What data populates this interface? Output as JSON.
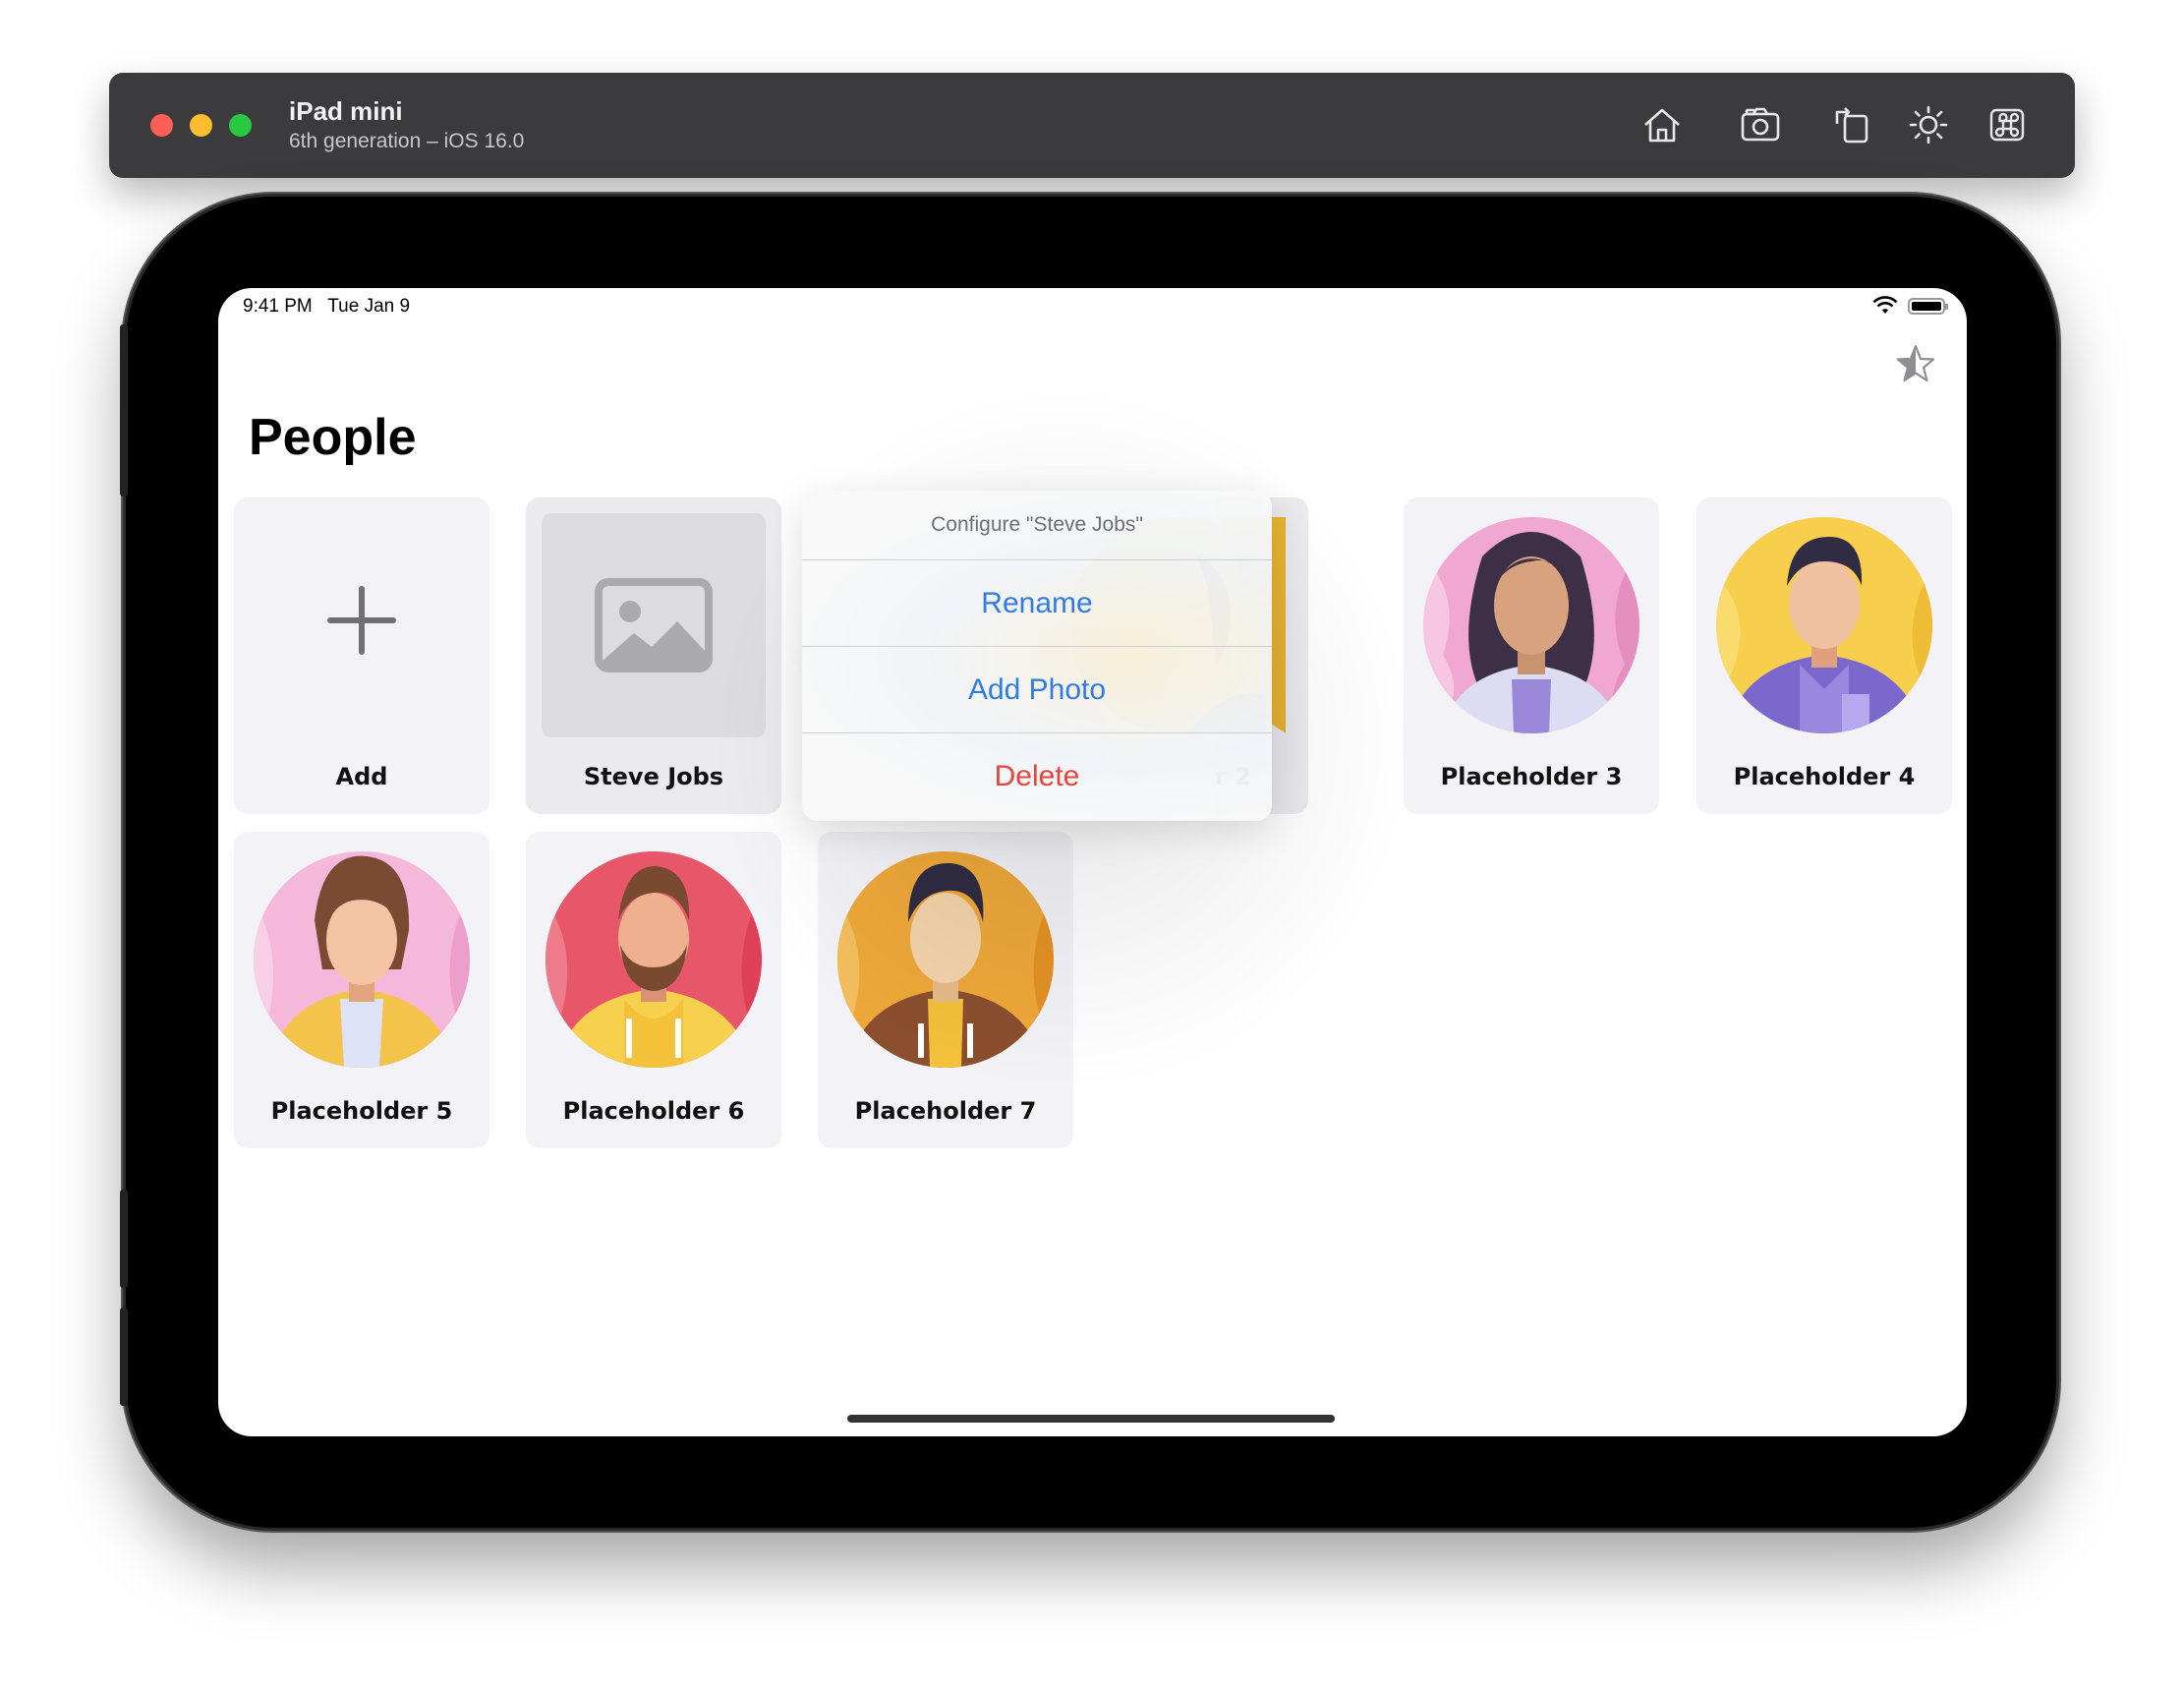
{
  "window": {
    "title": "iPad mini",
    "subtitle": "6th generation – iOS 16.0",
    "toolbar_icons": [
      "home-icon",
      "screenshot-icon",
      "rotate-icon",
      "appearance-icon",
      "command-icon"
    ]
  },
  "status_bar": {
    "time": "9:41 PM   Tue Jan 9"
  },
  "page": {
    "title": "People",
    "favorite_icon": "star-icon"
  },
  "grid": {
    "add_label": "Add",
    "people": [
      {
        "name": "Steve Jobs",
        "avatar": "image-placeholder-icon"
      },
      {
        "name": "r 2",
        "avatar": "avatar-yellow-bg"
      },
      {
        "name": "Placeholder 3",
        "avatar": "avatar-woman-pink-bg"
      },
      {
        "name": "Placeholder 4",
        "avatar": "avatar-man-yellow-bg"
      },
      {
        "name": "Placeholder 5",
        "avatar": "avatar-woman-pink-bg"
      },
      {
        "name": "Placeholder 6",
        "avatar": "avatar-bearded-red-bg"
      },
      {
        "name": "Placeholder 7",
        "avatar": "avatar-man-orange-bg"
      }
    ]
  },
  "context_menu": {
    "header": "Configure \"Steve Jobs\"",
    "items": [
      {
        "label": "Rename",
        "color": "#2f7ce8"
      },
      {
        "label": "Add Photo",
        "color": "#2f7ce8"
      },
      {
        "label": "Delete",
        "color": "#e5453c"
      }
    ]
  },
  "colors": {
    "accent": "#2f7ce8",
    "destructive": "#e5453c",
    "tile_bg": "#f2f2f7"
  }
}
